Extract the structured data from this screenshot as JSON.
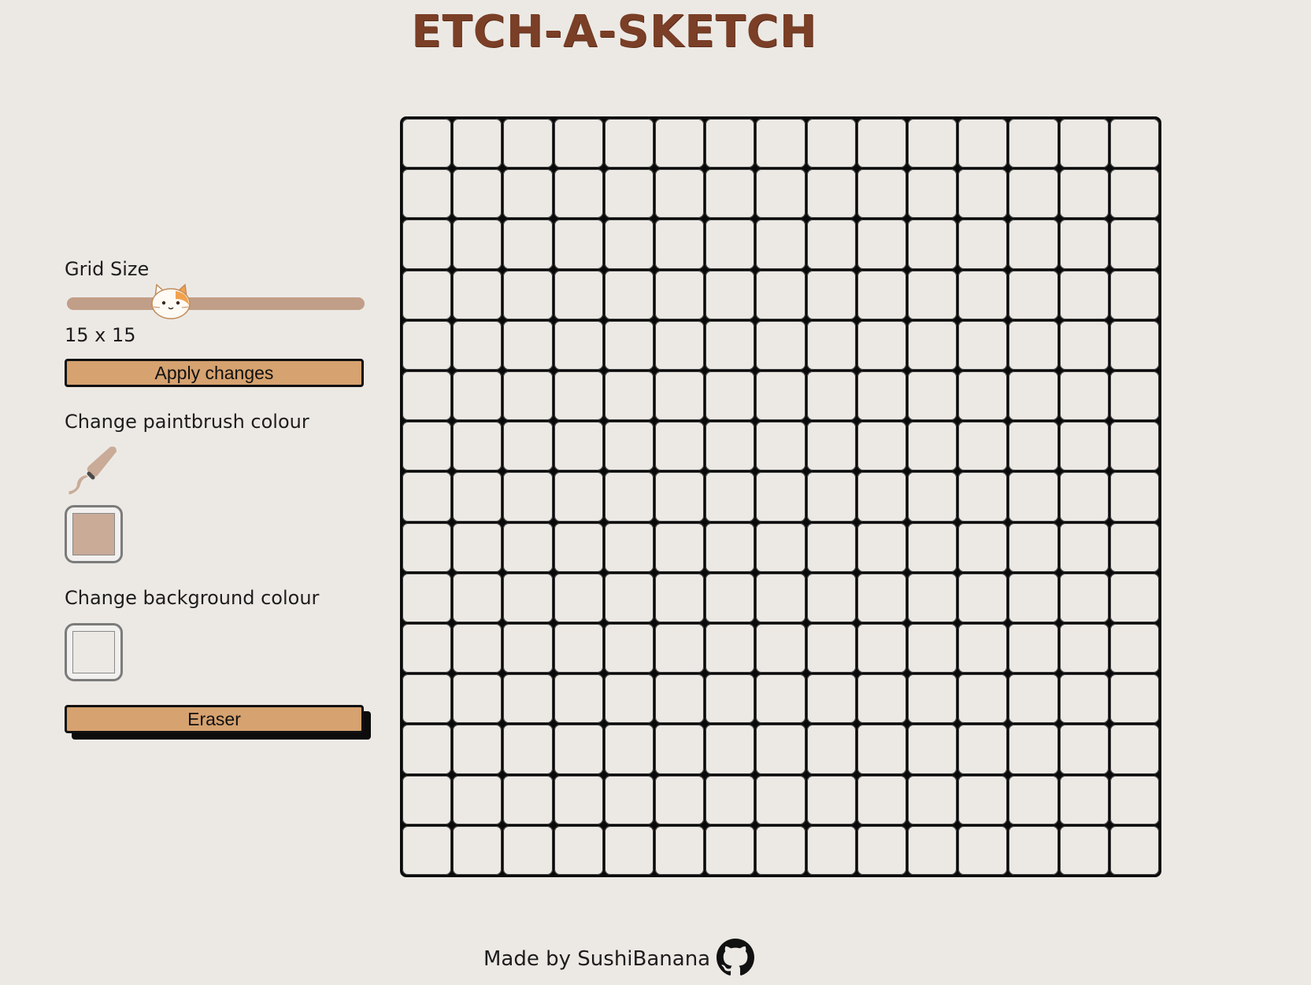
{
  "app": {
    "title": "ETCH-A-SKETCH"
  },
  "controls": {
    "grid_size_label": "Grid Size",
    "grid_size_value": "15 x 15",
    "grid_size": 15,
    "slider": {
      "min": 1,
      "max": 50,
      "value": 15,
      "thumb_icon": "cat-face-icon"
    },
    "apply_label": "Apply changes",
    "paint_label": "Change paintbrush colour",
    "paint_icon": "paintbrush-icon",
    "paint_color": "#c9ab98",
    "background_label": "Change background colour",
    "background_color": "#ece9e5",
    "eraser_label": "Eraser"
  },
  "board": {
    "rows": 15,
    "cols": 15,
    "cell_color": "#ece9e5",
    "line_color": "#0a0a0a"
  },
  "footer": {
    "text": "Made by SushiBanana",
    "icon": "github-icon"
  },
  "colors": {
    "page_background": "#ece9e5",
    "title": "#7a3f26",
    "button": "#d6a26f",
    "slider_track": "#c19e87"
  }
}
